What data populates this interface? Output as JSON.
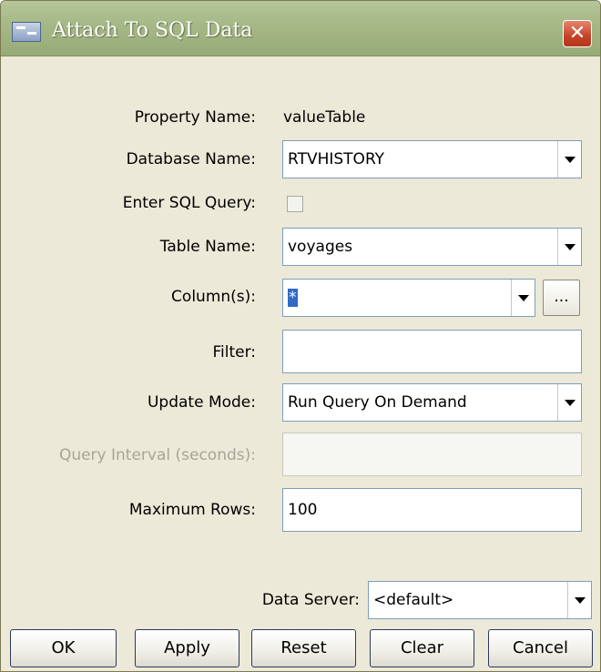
{
  "window": {
    "title": "Attach To SQL Data",
    "close_glyph": "✕"
  },
  "form": {
    "property_name": {
      "label": "Property Name:",
      "value": "valueTable"
    },
    "database_name": {
      "label": "Database Name:",
      "value": "RTVHISTORY"
    },
    "enter_sql_query": {
      "label": "Enter SQL Query:",
      "checked": false
    },
    "table_name": {
      "label": "Table Name:",
      "value": "voyages"
    },
    "columns": {
      "label": "Column(s):",
      "value": "*",
      "browse_label": "..."
    },
    "filter": {
      "label": "Filter:",
      "value": ""
    },
    "update_mode": {
      "label": "Update Mode:",
      "value": "Run Query On Demand"
    },
    "query_interval": {
      "label": "Query Interval (seconds):",
      "value": "",
      "enabled": false
    },
    "maximum_rows": {
      "label": "Maximum Rows:",
      "value": "100"
    },
    "data_server": {
      "label": "Data Server:",
      "value": "<default>"
    }
  },
  "buttons": {
    "ok": "OK",
    "apply": "Apply",
    "reset": "Reset",
    "clear": "Clear",
    "cancel": "Cancel"
  },
  "icons": {
    "app": "sql-window-icon",
    "close": "close-icon",
    "dropdown": "chevron-down-icon"
  }
}
